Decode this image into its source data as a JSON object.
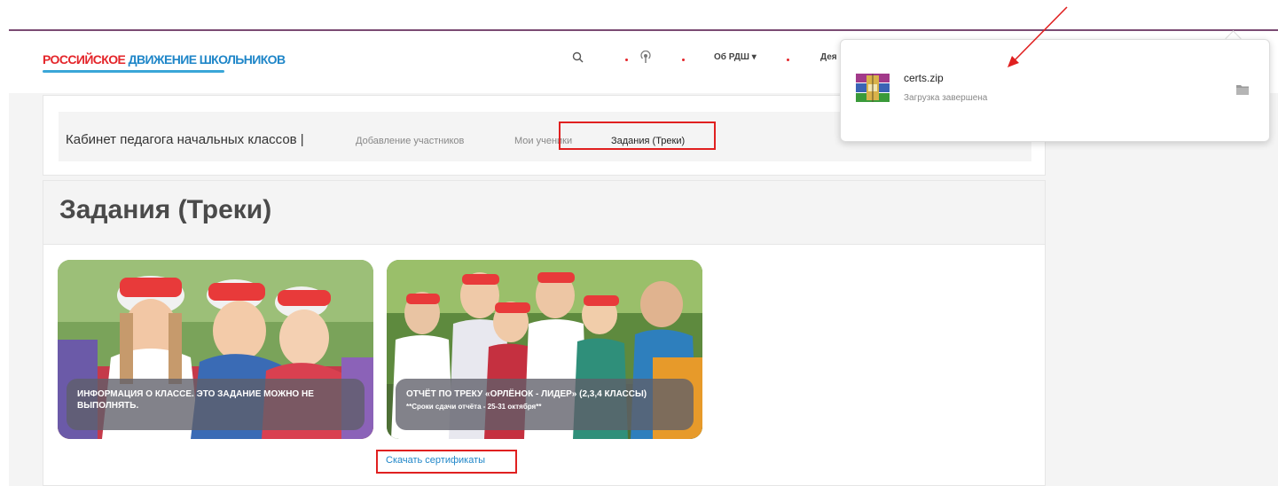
{
  "header": {
    "logo_part1": "РОССИЙСКОЕ",
    "logo_part2": "ДВИЖЕНИЕ ШКОЛЬНИКОВ",
    "menu_about": "Об РДШ ▾",
    "menu_activity": "Дея"
  },
  "nav": {
    "title": "Кабинет педагога начальных классов |",
    "links": [
      "Добавление участников",
      "Мои ученики",
      "Задания (Треки)"
    ]
  },
  "page": {
    "title": "Задания (Треки)"
  },
  "tiles": [
    {
      "caption": "ИНФОРМАЦИЯ О КЛАССЕ. ЭТО ЗАДАНИЕ МОЖНО НЕ ВЫПОЛНЯТЬ.",
      "subcaption": ""
    },
    {
      "caption": "ОТЧЁТ ПО ТРЕКУ «ОРЛЁНОК - ЛИДЕР» (2,3,4 КЛАССЫ)",
      "subcaption": "**Сроки сдачи отчёта - 25-31 октября**"
    }
  ],
  "download_link": "Скачать сертификаты",
  "download_popup": {
    "file_name": "certs.zip",
    "status": "Загрузка завершена"
  },
  "colors": {
    "accent_red": "#e4252a",
    "accent_blue": "#1f86c8",
    "highlight_box": "#e02020"
  }
}
